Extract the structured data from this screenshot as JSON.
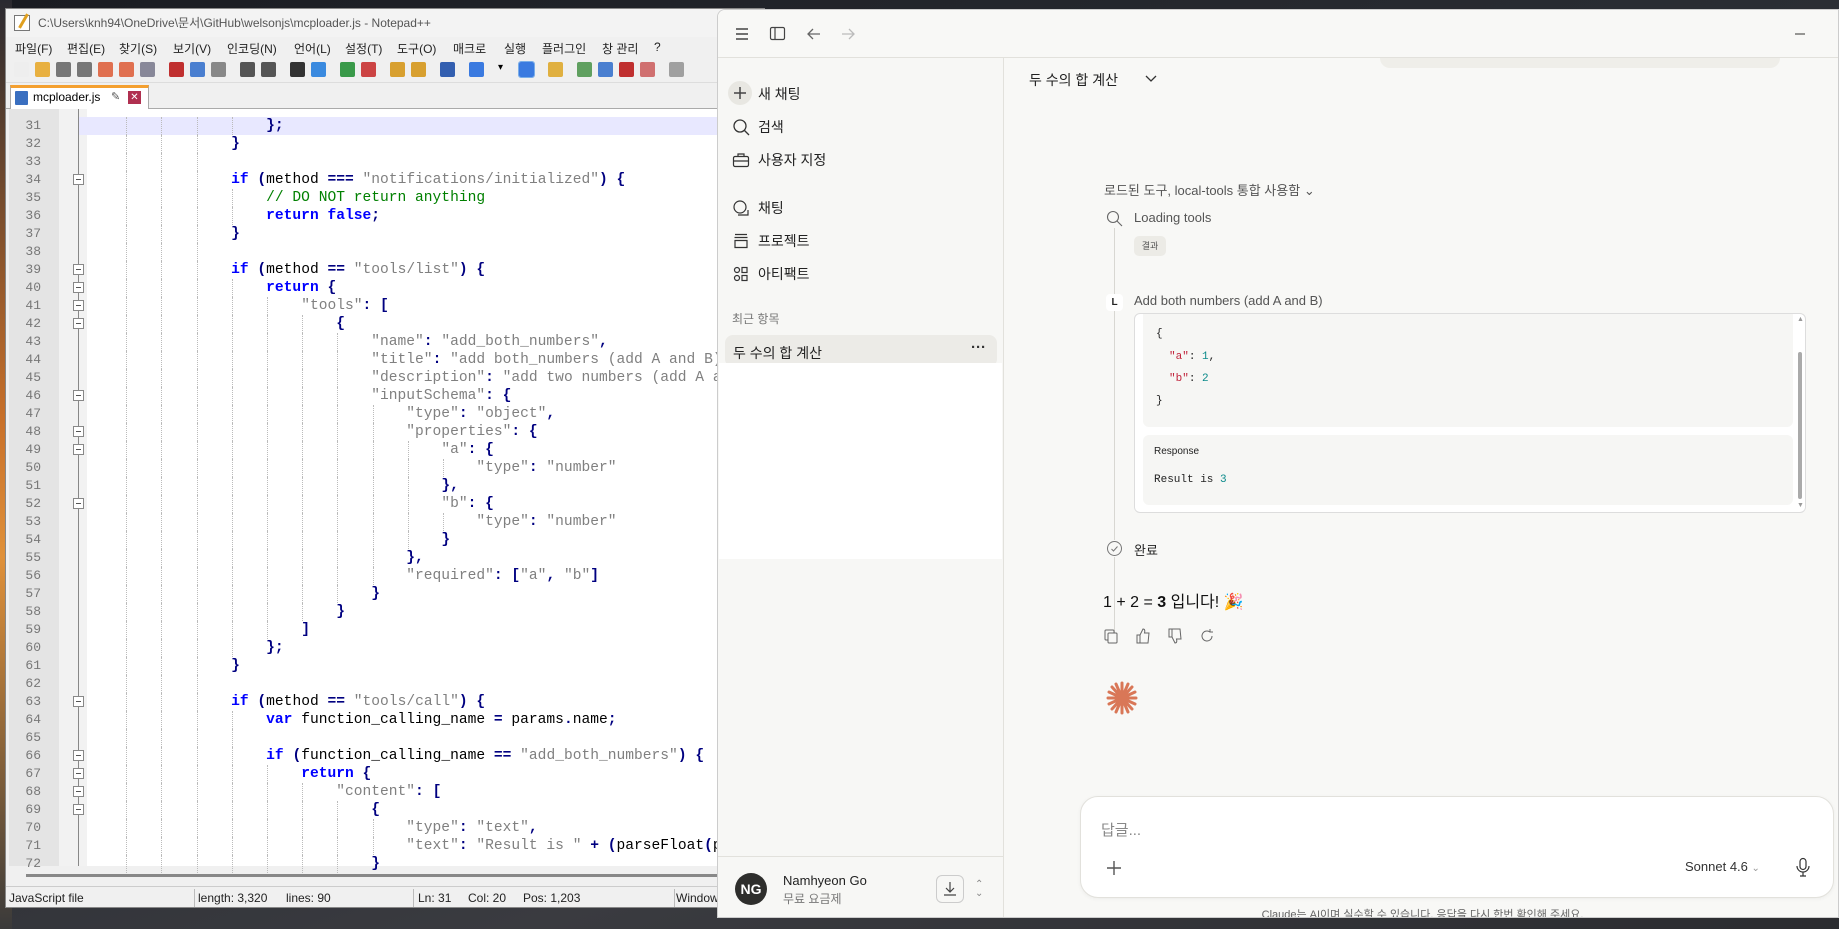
{
  "notepad": {
    "title": "C:\\Users\\knh94\\OneDrive\\문서\\GitHub\\welsonjs\\mcploader.js - Notepad++",
    "menu": [
      "파일(F)",
      "편집(E)",
      "찾기(S)",
      "보기(V)",
      "인코딩(N)",
      "언어(L)",
      "설정(T)",
      "도구(O)",
      "매크로",
      "실행",
      "플러그인",
      "창 관리",
      "?"
    ],
    "toolbar_icons": [
      "new-file-icon",
      "open-file-icon",
      "save-icon",
      "save-all-icon",
      "close-icon",
      "close-all-icon",
      "print-icon",
      "cut-icon",
      "copy-icon",
      "paste-icon",
      "undo-icon",
      "redo-icon",
      "find-icon",
      "replace-icon",
      "zoom-in-icon",
      "zoom-out-icon",
      "sync-vertical-icon",
      "sync-horizontal-icon",
      "word-wrap-icon",
      "show-all-chars-icon",
      "dropdown-icon",
      "indent-guide-icon",
      "udl-icon",
      "doc-map-icon",
      "doc-list-icon",
      "function-list-icon",
      "folder-workspace-icon",
      "monitoring-icon"
    ],
    "tab": {
      "label": "mcploader.js"
    },
    "current_line": 31,
    "first_line": 31,
    "folds": [
      34,
      39,
      40,
      41,
      42,
      46,
      48,
      49,
      52,
      63,
      66,
      67,
      68,
      69
    ],
    "lines": [
      "                    };",
      "                }",
      "",
      "                if (method === \"notifications/initialized\") {",
      "                    // DO NOT return anything",
      "                    return false;",
      "                }",
      "",
      "                if (method == \"tools/list\") {",
      "                    return {",
      "                        \"tools\": [",
      "                            {",
      "                                \"name\": \"add_both_numbers\",",
      "                                \"title\": \"add both_numbers (add A and B)\",",
      "                                \"description\": \"add two numbers (add A and B)\",",
      "                                \"inputSchema\": {",
      "                                    \"type\": \"object\",",
      "                                    \"properties\": {",
      "                                        \"a\": {",
      "                                            \"type\": \"number\"",
      "                                        },",
      "                                        \"b\": {",
      "                                            \"type\": \"number\"",
      "                                        }",
      "                                    },",
      "                                    \"required\": [\"a\", \"b\"]",
      "                                }",
      "                            }",
      "                        ]",
      "                    };",
      "                }",
      "",
      "                if (method == \"tools/call\") {",
      "                    var function_calling_name = params.name;",
      "",
      "                    if (function_calling_name == \"add_both_numbers\") {",
      "                        return {",
      "                            \"content\": [",
      "                                {",
      "                                    \"type\": \"text\",",
      "                                    \"text\": \"Result is \" + (parseFloat(params.arguments.a) + parseFloat(params.arguments.b))",
      "                                }"
    ],
    "status": {
      "type": "JavaScript file",
      "length": "length: 3,320",
      "lines": "lines: 90",
      "ln": "Ln: 31",
      "col": "Col: 20",
      "pos": "Pos: 1,203",
      "eol": "Windows"
    }
  },
  "claude": {
    "sidebar": {
      "items": [
        {
          "label": "새 채팅",
          "icon": "plus-icon"
        },
        {
          "label": "검색",
          "icon": "search-icon"
        },
        {
          "label": "사용자 지정",
          "icon": "briefcase-icon"
        },
        {
          "label": "채팅",
          "icon": "chat-icon"
        },
        {
          "label": "프로젝트",
          "icon": "project-icon"
        },
        {
          "label": "아티팩트",
          "icon": "artifact-icon"
        }
      ],
      "recent_heading": "최근 항목",
      "recent": [
        {
          "label": "두 수의 합 계산"
        }
      ],
      "user": {
        "initials": "NG",
        "name": "Namhyeon Go",
        "plan": "무료 요금제"
      }
    },
    "header": {
      "title": "두 수의 합 계산"
    },
    "tools_summary": "로드된 도구, local-tools 통합 사용함",
    "loading_tools": "Loading tools",
    "result_chip": "결과",
    "tool_badge": "L",
    "tool_call_title": "Add both numbers (add A and B)",
    "request_json": {
      "open": "{",
      "a_key": "\"a\"",
      "a_val": "1",
      "b_key": "\"b\"",
      "b_val": "2",
      "close": "}"
    },
    "response_label": "Response",
    "response_text": "Result is ",
    "response_value": "3",
    "done": "완료",
    "answer": {
      "prefix": "1 + 2 = ",
      "bold": "3",
      "suffix": " 입니다! 🎉"
    },
    "input_placeholder": "답글...",
    "model": "Sonnet 4.6",
    "disclaimer": "Claude는 AI이며 실수할 수 있습니다. 응답을 다시 한번 확인해 주세요.",
    "accent": "#d97757"
  }
}
